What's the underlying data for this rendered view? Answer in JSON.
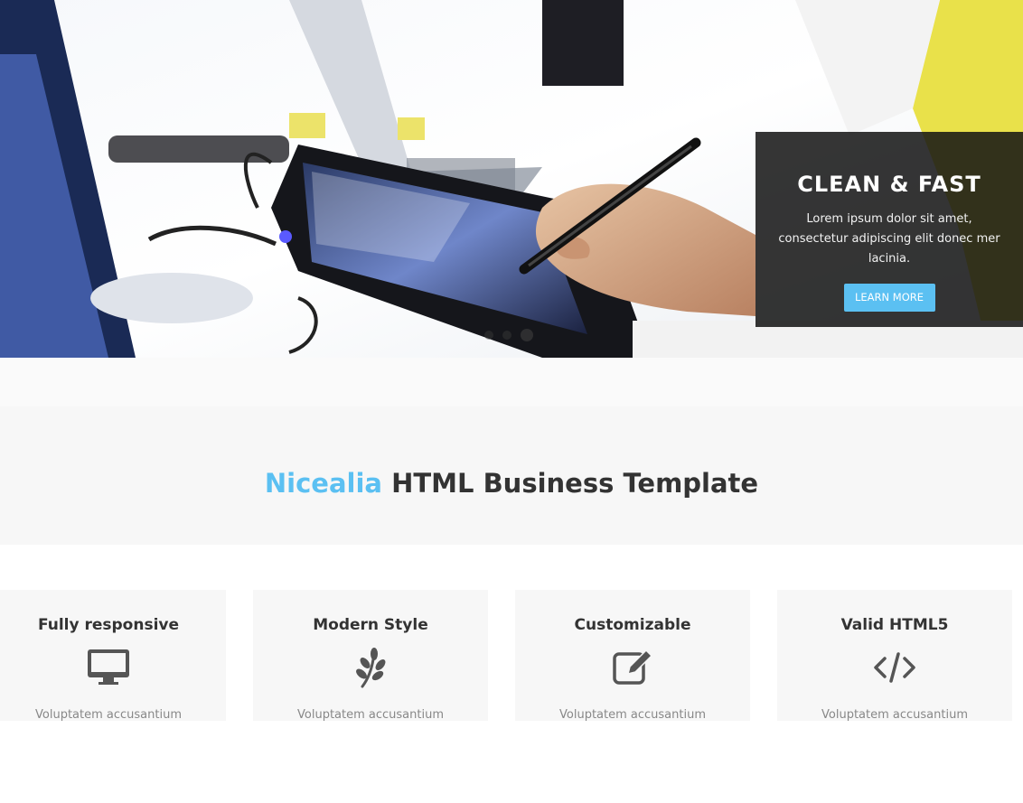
{
  "hero": {
    "caption": {
      "title": "CLEAN & FAST",
      "text": "Lorem ipsum dolor sit amet, consectetur adipiscing elit donec mer lacinia.",
      "button_label": "LEARN MORE"
    },
    "slides_total": 3,
    "active_slide": 3
  },
  "section": {
    "title_accent": "Nicealia",
    "title_rest": " HTML Business Template"
  },
  "features": [
    {
      "title": "Fully responsive",
      "icon": "desktop-icon",
      "text": "Voluptatem accusantium"
    },
    {
      "title": "Modern Style",
      "icon": "leaf-icon",
      "text": "Voluptatem accusantium"
    },
    {
      "title": "Customizable",
      "icon": "edit-icon",
      "text": "Voluptatem accusantium"
    },
    {
      "title": "Valid HTML5",
      "icon": "code-icon",
      "text": "Voluptatem accusantium"
    }
  ],
  "colors": {
    "accent": "#5bc0f2",
    "heading": "#333333",
    "band_bg": "#f7f7f7",
    "caption_bg": "#141414"
  }
}
